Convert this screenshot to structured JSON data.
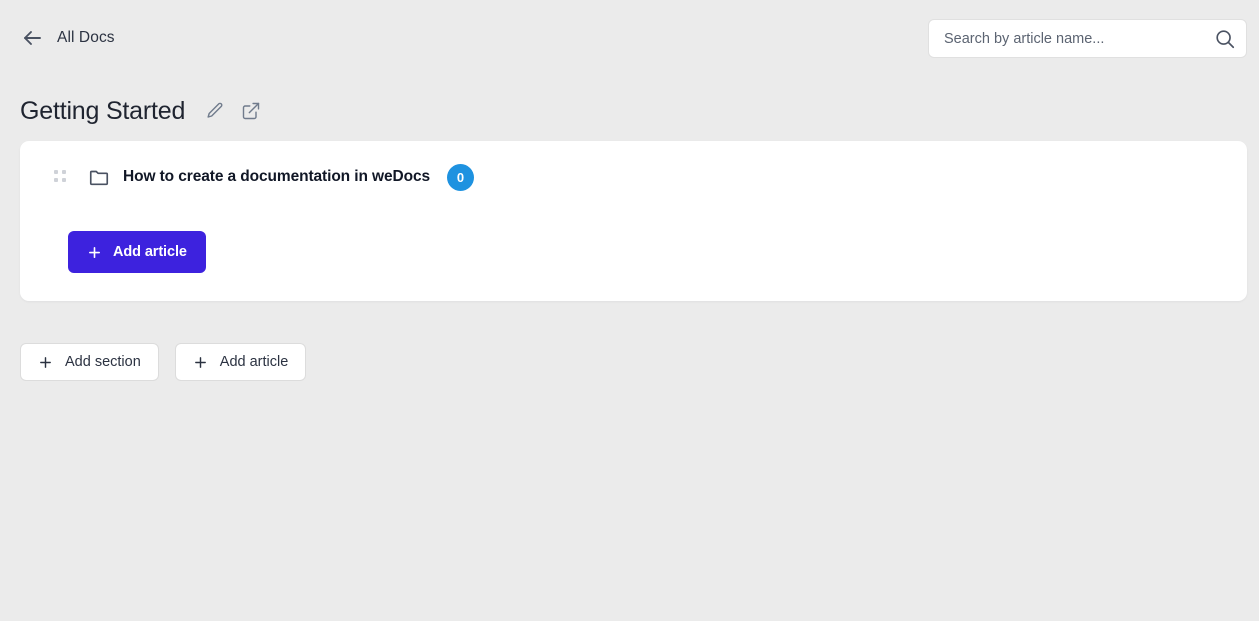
{
  "header": {
    "back_label": "All Docs",
    "back_icon": "arrow-left-icon"
  },
  "search": {
    "placeholder": "Search by article name...",
    "value": "",
    "icon": "search-icon"
  },
  "page": {
    "title": "Getting Started",
    "edit_icon": "pencil-icon",
    "external_icon": "external-link-icon"
  },
  "section": {
    "drag_icon": "drag-handle-icon",
    "folder_icon": "folder-icon",
    "title": "How to create a documentation in weDocs",
    "count": "0",
    "add_article_label": "Add article",
    "add_icon": "plus-icon"
  },
  "footer": {
    "add_section_label": "Add section",
    "add_article_label": "Add article",
    "add_icon": "plus-icon"
  },
  "colors": {
    "page_background": "#ebebeb",
    "card_background": "#ffffff",
    "primary_button": "#3d22de",
    "badge": "#1e92e0",
    "text": "#111726",
    "muted_text": "#5c6472",
    "border": "#dcdcdc"
  }
}
